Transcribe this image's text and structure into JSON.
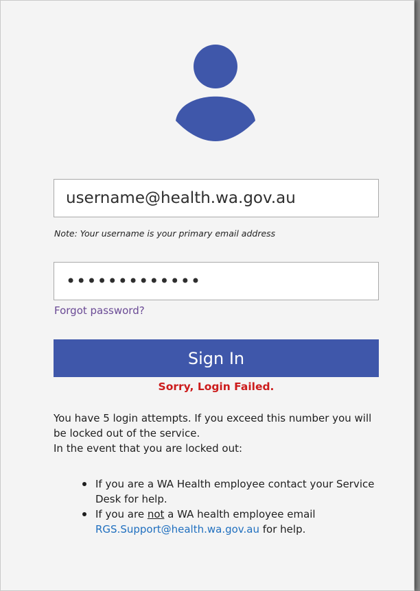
{
  "colors": {
    "accent": "#3f57aa",
    "error": "#cc1b1b",
    "link": "#1f6fbf",
    "forgot_link": "#6a4a95"
  },
  "avatar": {
    "icon": "user-silhouette-icon"
  },
  "username": {
    "value": "username@health.wa.gov.au"
  },
  "note": "Note: Your username is your primary email address",
  "password": {
    "value": "•••••••••••••"
  },
  "forgot_password": "Forgot password?",
  "sign_in_label": "Sign In",
  "error_message": "Sorry, Login Failed.",
  "info": {
    "line1": "You have 5 login attempts. If you exceed this number you will be locked out of the service.",
    "line2": "In the event that you are locked out:"
  },
  "bullets": {
    "item1": "If you are a WA Health employee contact your Service Desk for help.",
    "item2_prefix": "If you are ",
    "item2_underline": "not",
    "item2_middle": " a WA health employee email ",
    "item2_email": "RGS.Support@health.wa.gov.au",
    "item2_suffix": " for help."
  }
}
